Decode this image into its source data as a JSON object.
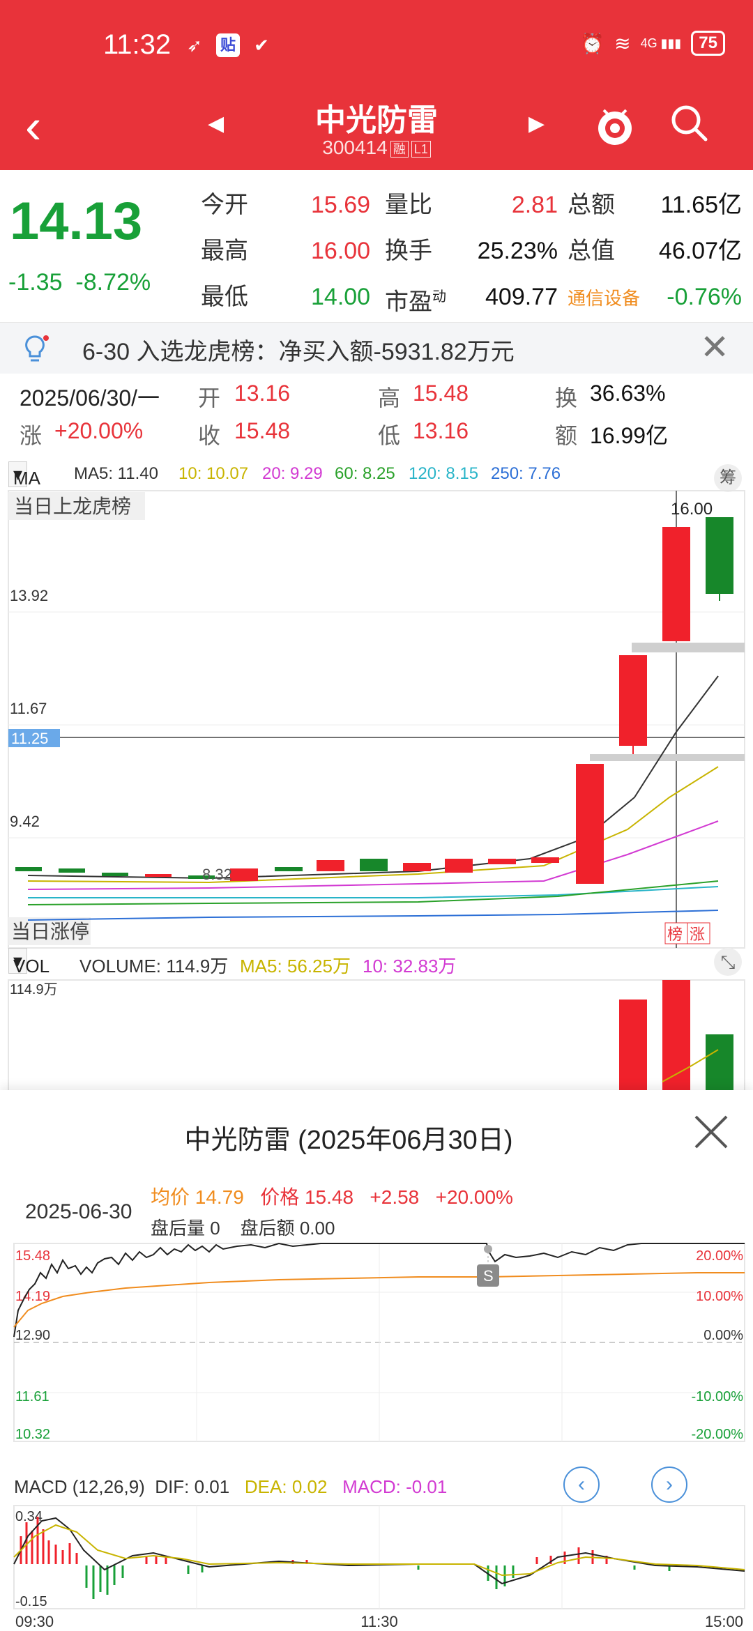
{
  "status": {
    "time": "11:32",
    "battery": "75",
    "signal": "4G"
  },
  "nav": {
    "title": "中光防雷",
    "code": "300414",
    "tag1": "融",
    "tag2": "L1"
  },
  "quote": {
    "price": "14.13",
    "change": "-1.35",
    "change_pct": "-8.72%",
    "col1": [
      {
        "label": "今开",
        "value": "15.69"
      },
      {
        "label": "最高",
        "value": "16.00"
      },
      {
        "label": "最低",
        "value": "14.00"
      }
    ],
    "col2": [
      {
        "label": "量比",
        "value": "2.81"
      },
      {
        "label": "换手",
        "value": "25.23%"
      },
      {
        "label": "市盈",
        "sup": "动",
        "value": "409.77"
      }
    ],
    "col3": [
      {
        "label": "总额",
        "value": "11.65亿"
      },
      {
        "label": "总值",
        "value": "46.07亿"
      },
      {
        "label": "通信设备",
        "value": "-0.76%"
      }
    ]
  },
  "notice": {
    "text": "6-30 入选龙虎榜：净买入额-5931.82万元"
  },
  "day": {
    "date": "2025/06/30/一",
    "open_label": "开",
    "open": "13.16",
    "high_label": "高",
    "high": "15.48",
    "turn_label": "换",
    "turn": "36.63%",
    "rise_label": "涨",
    "rise": "+20.00%",
    "close_label": "收",
    "close": "15.48",
    "low_label": "低",
    "low": "13.16",
    "amount_label": "额",
    "amount": "16.99亿"
  },
  "kline": {
    "ma_button": "MA",
    "ma5": "MA5: 11.40",
    "ma10": "10: 10.07",
    "ma20": "20: 9.29",
    "ma60": "60: 8.25",
    "ma120": "120: 8.15",
    "ma250": "250: 7.76",
    "chou": "筹",
    "top_label": "当日上龙虎榜",
    "bottom_label": "当日涨停",
    "y_labels": [
      "13.92",
      "11.67",
      "9.42"
    ],
    "crosshair_value": "11.25",
    "high_label": "16.00",
    "low_label": "8.32",
    "tags": [
      "榜",
      "涨"
    ],
    "colors": {
      "up": "#f0212b",
      "down": "#17872a",
      "ma5": "#333333",
      "ma10": "#c8b400",
      "ma20": "#d23ad2",
      "ma60": "#2aa12a",
      "ma120": "#28b4c8",
      "ma250": "#2c6fd6"
    }
  },
  "volume": {
    "button": "VOL",
    "volume": "VOLUME: 114.9万",
    "ma5": "MA5: 56.25万",
    "ma10": "10: 32.83万",
    "y_label": "114.9万"
  },
  "sheet": {
    "title": "中光防雷 (2025年06月30日)",
    "date": "2025-06-30",
    "avg": "均价 14.79",
    "price": "价格 15.48",
    "change": "+2.58",
    "pct": "+20.00%",
    "after_vol": "盘后量 0",
    "after_amt": "盘后额 0.00",
    "left_axis": [
      "15.48",
      "14.19",
      "12.90",
      "11.61",
      "10.32"
    ],
    "right_axis": [
      "20.00%",
      "10.00%",
      "0.00%",
      "-10.00%",
      "-20.00%"
    ],
    "s_tag": "S",
    "macd_label": "MACD (12,26,9)",
    "dif": "DIF: 0.01",
    "dea": "DEA: 0.02",
    "macd": "MACD: -0.01",
    "macd_axis": [
      "0.34",
      "-0.15"
    ],
    "time_axis": [
      "09:30",
      "11:30",
      "15:00"
    ]
  }
}
